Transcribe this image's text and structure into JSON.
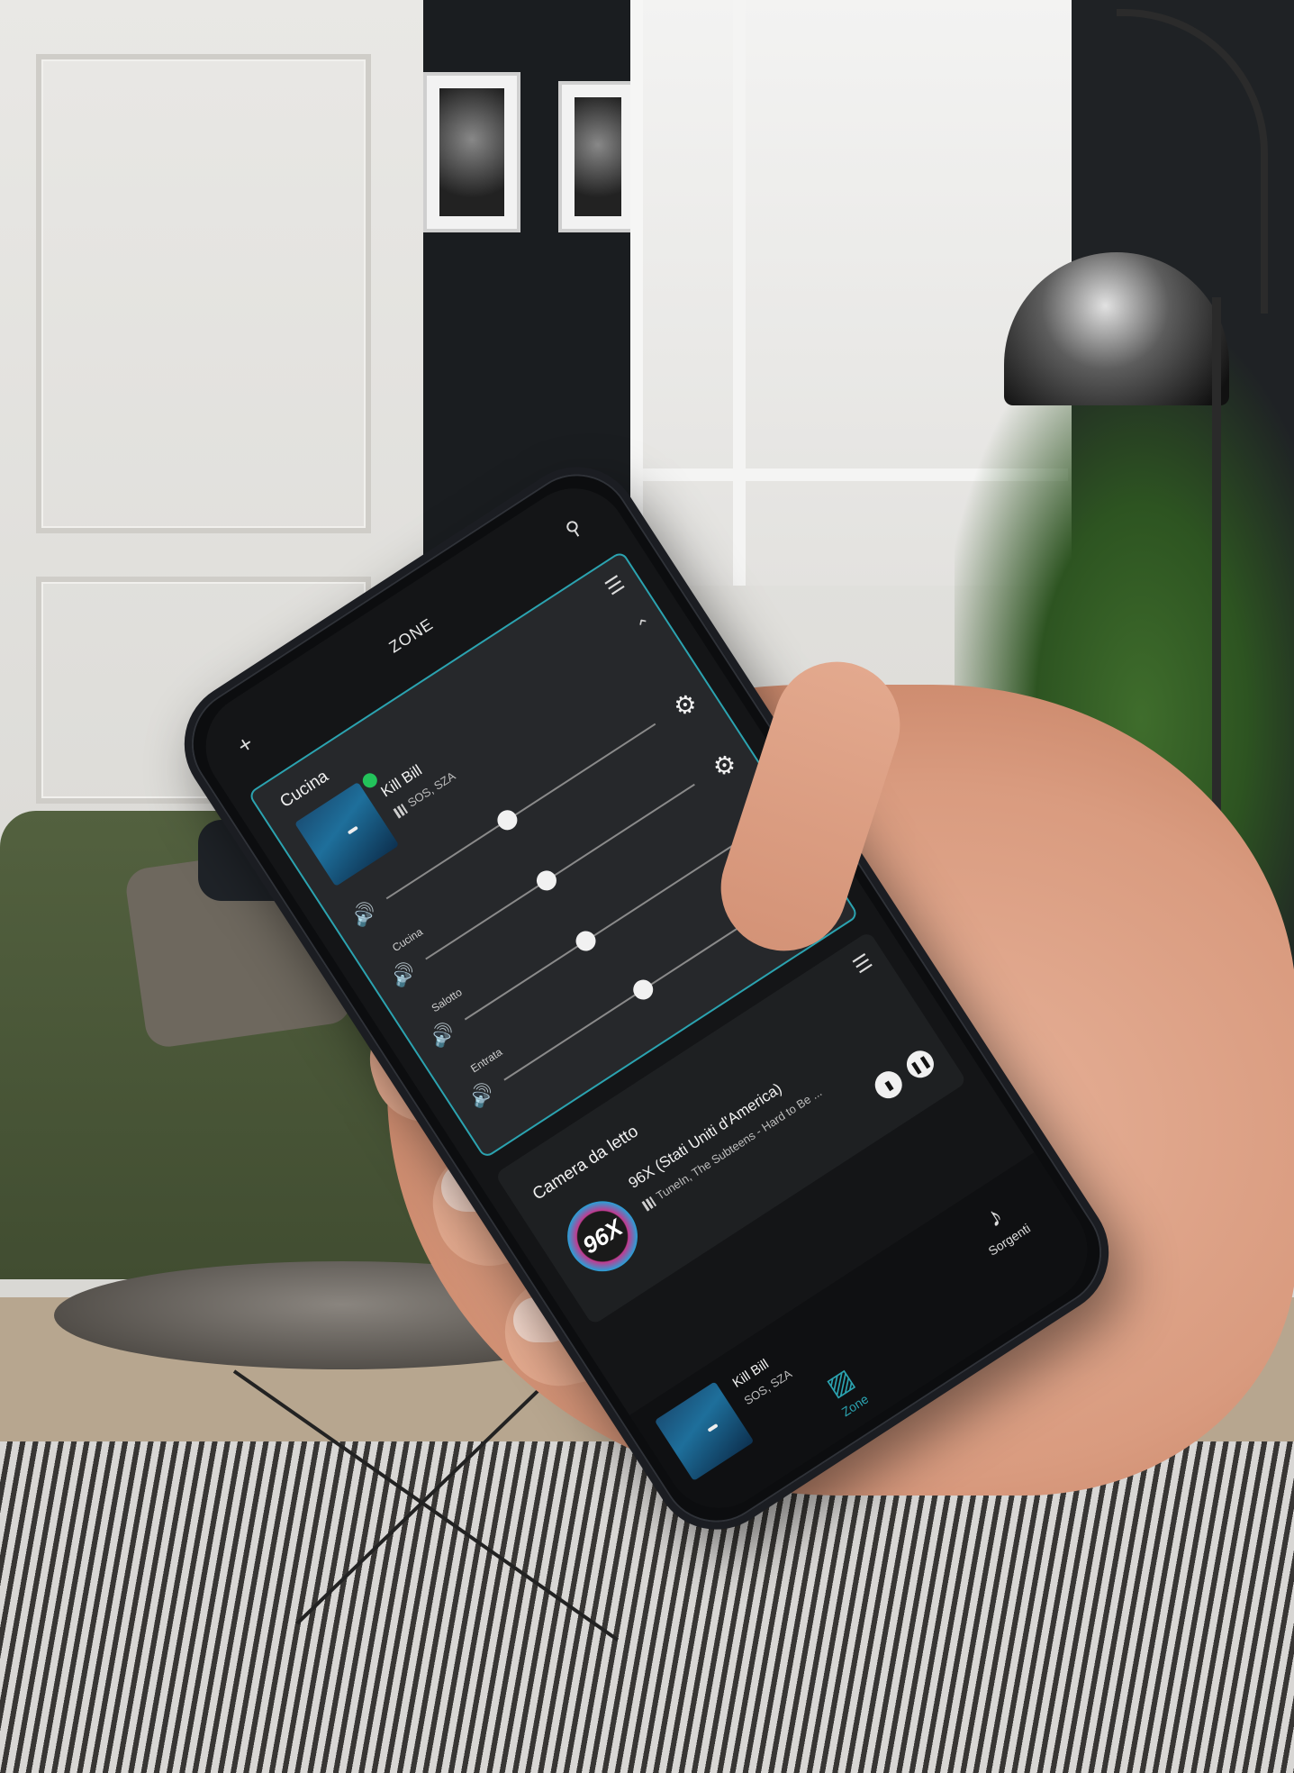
{
  "app": {
    "title": "ZONE",
    "icons": {
      "add": "plus-icon",
      "search": "search-icon",
      "queue": "queue-icon",
      "volume": "volume-icon",
      "settings": "gear-icon",
      "collapse": "chevron-up-icon"
    },
    "accent_color": "#2ba3b0",
    "playing_color": "#23c35b"
  },
  "active_zone": {
    "name": "Cucina",
    "track": "Kill Bill",
    "artist": "SOS, SZA",
    "master_volume": 0.45,
    "sub_zones": [
      {
        "name": "Cucina",
        "volume": 0.45
      },
      {
        "name": "Salotto",
        "volume": 0.45
      },
      {
        "name": "Entrata",
        "volume": 0.45
      }
    ]
  },
  "second_zone": {
    "name": "Camera da letto",
    "station": "96X (Stati Uniti d'America)",
    "details": "TuneIn, The Subteens - Hard to Be ...",
    "logo_text": "96X"
  },
  "mini_player": {
    "track": "Kill Bill",
    "artist": "SOS, SZA"
  },
  "bottom_nav": {
    "items": [
      {
        "label": "Zone",
        "icon": "speaker-icon",
        "active": true
      },
      {
        "label": "Sorgenti",
        "icon": "music-note-icon",
        "active": false
      }
    ]
  }
}
